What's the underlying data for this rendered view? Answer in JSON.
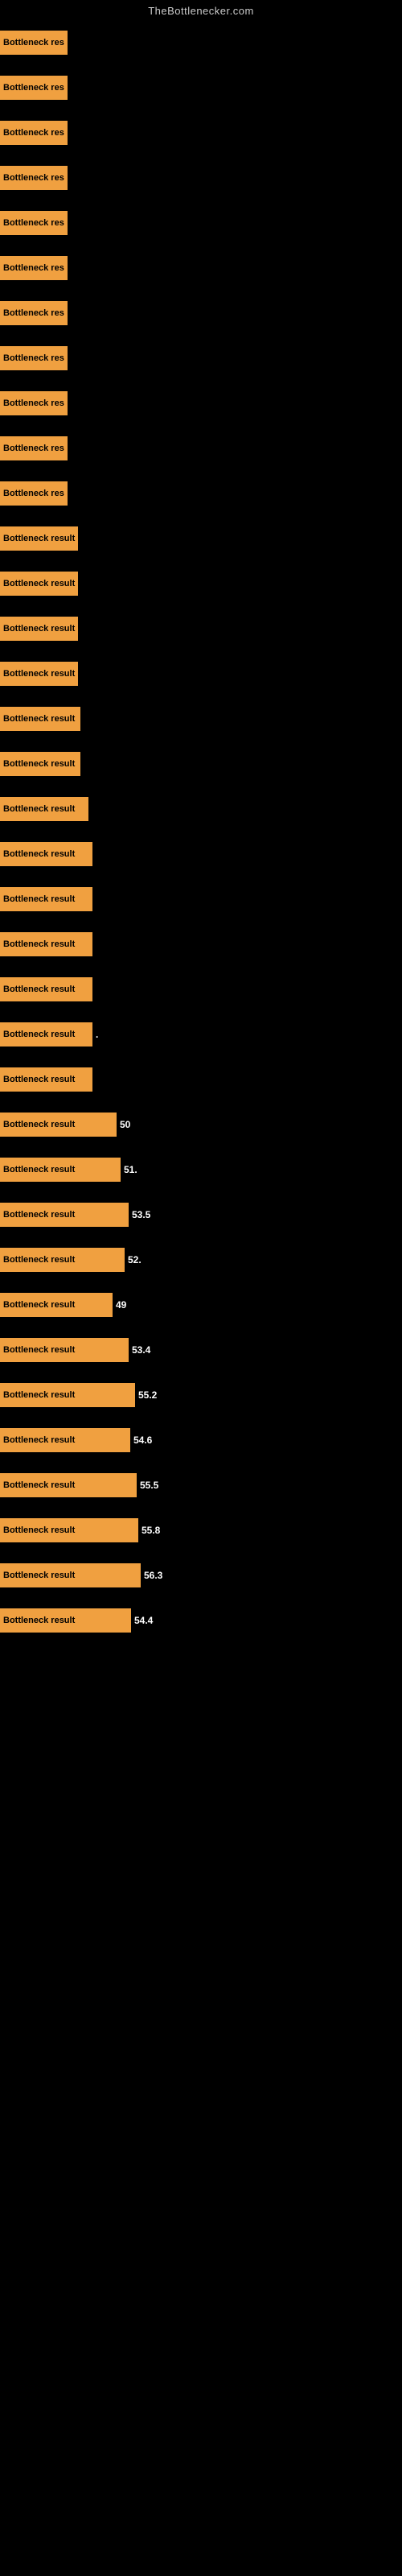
{
  "site": {
    "title": "TheBottlenecker.com"
  },
  "bars": [
    {
      "label": "Bottleneck res",
      "width": 75,
      "value": null
    },
    {
      "label": "Bottleneck res",
      "width": 75,
      "value": null
    },
    {
      "label": "Bottleneck res",
      "width": 75,
      "value": null
    },
    {
      "label": "Bottleneck res",
      "width": 75,
      "value": null
    },
    {
      "label": "Bottleneck res",
      "width": 75,
      "value": null
    },
    {
      "label": "Bottleneck res",
      "width": 75,
      "value": null
    },
    {
      "label": "Bottleneck res",
      "width": 75,
      "value": null
    },
    {
      "label": "Bottleneck res",
      "width": 75,
      "value": null
    },
    {
      "label": "Bottleneck res",
      "width": 75,
      "value": null
    },
    {
      "label": "Bottleneck res",
      "width": 75,
      "value": null
    },
    {
      "label": "Bottleneck res",
      "width": 75,
      "value": null
    },
    {
      "label": "Bottleneck result",
      "width": 95,
      "value": null
    },
    {
      "label": "Bottleneck result",
      "width": 95,
      "value": null
    },
    {
      "label": "Bottleneck result",
      "width": 95,
      "value": null
    },
    {
      "label": "Bottleneck result",
      "width": 95,
      "value": null
    },
    {
      "label": "Bottleneck result",
      "width": 100,
      "value": null
    },
    {
      "label": "Bottleneck result",
      "width": 100,
      "value": null
    },
    {
      "label": "Bottleneck result",
      "width": 110,
      "value": null
    },
    {
      "label": "Bottleneck result",
      "width": 115,
      "value": null
    },
    {
      "label": "Bottleneck result",
      "width": 115,
      "value": null
    },
    {
      "label": "Bottleneck result",
      "width": 115,
      "value": null
    },
    {
      "label": "Bottleneck result",
      "width": 115,
      "value": null
    },
    {
      "label": "Bottleneck result",
      "width": 115,
      "value": "."
    },
    {
      "label": "Bottleneck result",
      "width": 115,
      "value": null
    },
    {
      "label": "Bottleneck result",
      "width": 145,
      "value": "50"
    },
    {
      "label": "Bottleneck result",
      "width": 150,
      "value": "51."
    },
    {
      "label": "Bottleneck result",
      "width": 160,
      "value": "53.5"
    },
    {
      "label": "Bottleneck result",
      "width": 155,
      "value": "52."
    },
    {
      "label": "Bottleneck result",
      "width": 140,
      "value": "49"
    },
    {
      "label": "Bottleneck result",
      "width": 160,
      "value": "53.4"
    },
    {
      "label": "Bottleneck result",
      "width": 168,
      "value": "55.2"
    },
    {
      "label": "Bottleneck result",
      "width": 162,
      "value": "54.6"
    },
    {
      "label": "Bottleneck result",
      "width": 170,
      "value": "55.5"
    },
    {
      "label": "Bottleneck result",
      "width": 172,
      "value": "55.8"
    },
    {
      "label": "Bottleneck result",
      "width": 175,
      "value": "56.3"
    },
    {
      "label": "Bottleneck result",
      "width": 163,
      "value": "54.4"
    }
  ]
}
